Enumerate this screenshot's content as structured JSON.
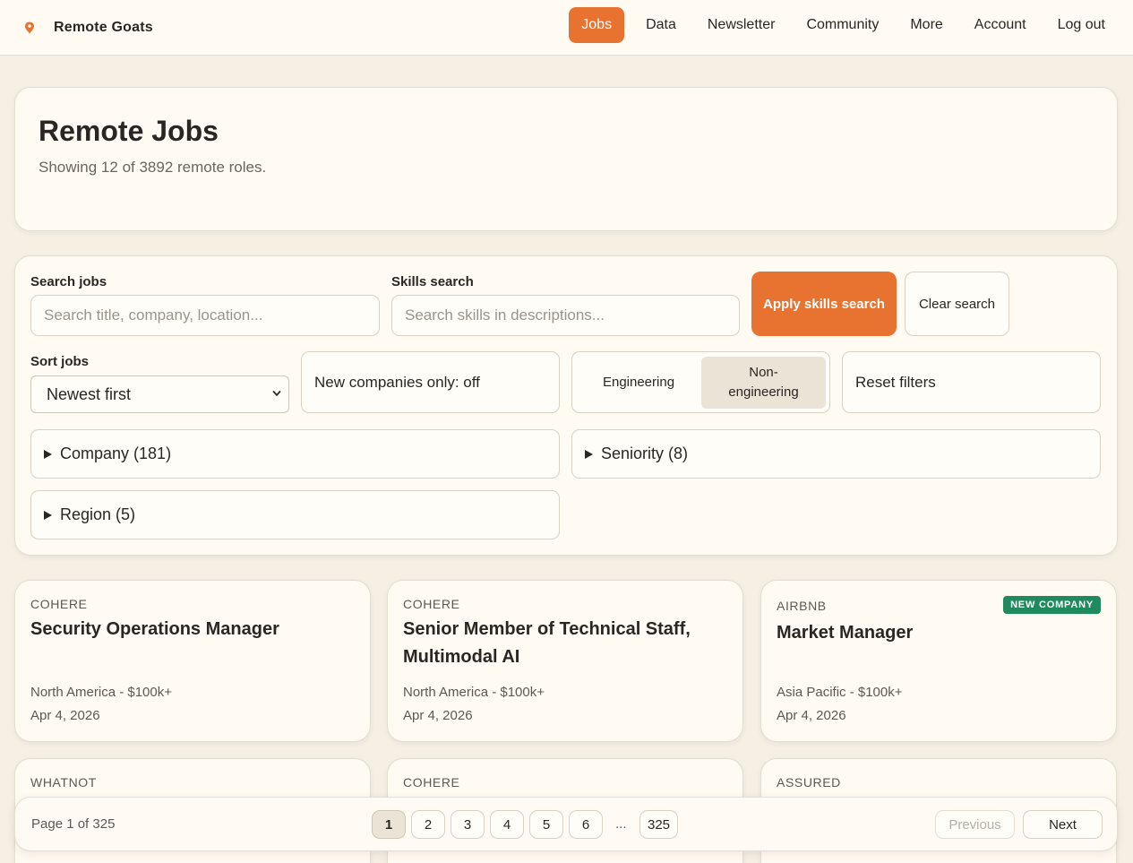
{
  "brand": {
    "name": "Remote Goats",
    "accent": "#e8722f"
  },
  "nav": {
    "items": [
      {
        "label": "Jobs",
        "active": true
      },
      {
        "label": "Data"
      },
      {
        "label": "Newsletter"
      },
      {
        "label": "Community"
      },
      {
        "label": "More"
      },
      {
        "label": "Account"
      },
      {
        "label": "Log out"
      }
    ]
  },
  "hero": {
    "title": "Remote Jobs",
    "subtitle": "Showing 12 of 3892 remote roles."
  },
  "filters": {
    "search_label": "Search jobs",
    "search_placeholder": "Search title, company, location...",
    "skills_label": "Skills search",
    "skills_placeholder": "Search skills in descriptions...",
    "apply_label": "Apply skills search",
    "clear_label": "Clear search",
    "sort_label": "Sort jobs",
    "sort_value": "Newest first",
    "new_companies_label": "New companies only: off",
    "segment": {
      "options": [
        "Engineering",
        "Non-engineering"
      ],
      "selected": "Non-engineering"
    },
    "reset_label": "Reset filters",
    "company_group": "Company (181)",
    "seniority_group": "Seniority (8)",
    "region_group": "Region (5)"
  },
  "jobs": [
    {
      "company": "COHERE",
      "title": "Security Operations Manager",
      "location": "North America - $100k+",
      "date": "Apr 4, 2026"
    },
    {
      "company": "COHERE",
      "title": "Senior Member of Technical Staff, Multimodal AI",
      "location": "North America - $100k+",
      "date": "Apr 4, 2026"
    },
    {
      "company": "AIRBNB",
      "badge": "NEW COMPANY",
      "title": "Market Manager",
      "location": "Asia Pacific - $100k+",
      "date": "Apr 4, 2026"
    },
    {
      "company": "WHATNOT"
    },
    {
      "company": "COHERE"
    },
    {
      "company": "ASSURED"
    }
  ],
  "pager": {
    "info": "Page 1 of 325",
    "pages": [
      "1",
      "2",
      "3",
      "4",
      "5",
      "6"
    ],
    "current": "1",
    "ellipsis": "...",
    "last": "325",
    "prev_label": "Previous",
    "next_label": "Next"
  },
  "colors": {
    "badge_green": "#1f8a5e",
    "background": "#f5efe4",
    "card": "#fffaf2"
  },
  "icons": {
    "brand": "pin-icon",
    "select": "chevron-down-icon",
    "disclosure": "triangle-right-icon"
  }
}
